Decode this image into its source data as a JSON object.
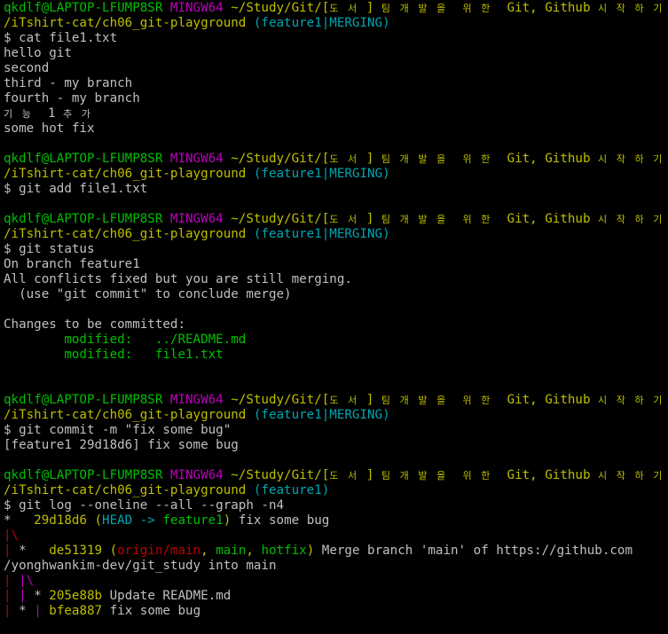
{
  "terminal": {
    "background": "#000000",
    "lines": [
      {
        "segments": [
          {
            "text": "qkdlf@LAPTOP-LFUMP8SR ",
            "color": "green"
          },
          {
            "text": "MINGW64 ",
            "color": "magenta"
          },
          {
            "text": "~/Study/Git/[",
            "color": "yellow"
          },
          {
            "text": "도 서 ",
            "color": "yellow",
            "small": true
          },
          {
            "text": "] ",
            "color": "yellow"
          },
          {
            "text": "팀 개 발 을  위 한 ",
            "color": "yellow",
            "small": true
          },
          {
            "text": " Git, Github ",
            "color": "yellow"
          },
          {
            "text": "시 작 하 기",
            "color": "yellow",
            "small": true
          }
        ]
      },
      {
        "segments": [
          {
            "text": "/iTshirt-cat/ch06_git-playground ",
            "color": "yellow"
          },
          {
            "text": "(feature1|MERGING)",
            "color": "cyan"
          }
        ]
      },
      {
        "segments": [
          {
            "text": "$ cat file1.txt",
            "color": "default"
          }
        ]
      },
      {
        "segments": [
          {
            "text": "hello git",
            "color": "default"
          }
        ]
      },
      {
        "segments": [
          {
            "text": "second",
            "color": "default"
          }
        ]
      },
      {
        "segments": [
          {
            "text": "third - my branch",
            "color": "default"
          }
        ]
      },
      {
        "segments": [
          {
            "text": "fourth - my branch",
            "color": "default"
          }
        ]
      },
      {
        "segments": [
          {
            "text": "기 능 ",
            "color": "default",
            "small": true
          },
          {
            "text": " 1 ",
            "color": "default"
          },
          {
            "text": "추 가",
            "color": "default",
            "small": true
          }
        ]
      },
      {
        "segments": [
          {
            "text": "some hot fix",
            "color": "default"
          }
        ]
      },
      {
        "segments": [
          {
            "text": "",
            "color": "default"
          }
        ]
      },
      {
        "segments": [
          {
            "text": "qkdlf@LAPTOP-LFUMP8SR ",
            "color": "green"
          },
          {
            "text": "MINGW64 ",
            "color": "magenta"
          },
          {
            "text": "~/Study/Git/[",
            "color": "yellow"
          },
          {
            "text": "도 서 ",
            "color": "yellow",
            "small": true
          },
          {
            "text": "] ",
            "color": "yellow"
          },
          {
            "text": "팀 개 발 을  위 한 ",
            "color": "yellow",
            "small": true
          },
          {
            "text": " Git, Github ",
            "color": "yellow"
          },
          {
            "text": "시 작 하 기",
            "color": "yellow",
            "small": true
          }
        ]
      },
      {
        "segments": [
          {
            "text": "/iTshirt-cat/ch06_git-playground ",
            "color": "yellow"
          },
          {
            "text": "(feature1|MERGING)",
            "color": "cyan"
          }
        ]
      },
      {
        "segments": [
          {
            "text": "$ git add file1.txt",
            "color": "default"
          }
        ]
      },
      {
        "segments": [
          {
            "text": "",
            "color": "default"
          }
        ]
      },
      {
        "segments": [
          {
            "text": "qkdlf@LAPTOP-LFUMP8SR ",
            "color": "green"
          },
          {
            "text": "MINGW64 ",
            "color": "magenta"
          },
          {
            "text": "~/Study/Git/[",
            "color": "yellow"
          },
          {
            "text": "도 서 ",
            "color": "yellow",
            "small": true
          },
          {
            "text": "] ",
            "color": "yellow"
          },
          {
            "text": "팀 개 발 을  위 한 ",
            "color": "yellow",
            "small": true
          },
          {
            "text": " Git, Github ",
            "color": "yellow"
          },
          {
            "text": "시 작 하 기",
            "color": "yellow",
            "small": true
          }
        ]
      },
      {
        "segments": [
          {
            "text": "/iTshirt-cat/ch06_git-playground ",
            "color": "yellow"
          },
          {
            "text": "(feature1|MERGING)",
            "color": "cyan"
          }
        ]
      },
      {
        "segments": [
          {
            "text": "$ git status",
            "color": "default"
          }
        ]
      },
      {
        "segments": [
          {
            "text": "On branch feature1",
            "color": "default"
          }
        ]
      },
      {
        "segments": [
          {
            "text": "All conflicts fixed but you are still merging.",
            "color": "default"
          }
        ]
      },
      {
        "segments": [
          {
            "text": "  (use \"git commit\" to conclude merge)",
            "color": "default"
          }
        ]
      },
      {
        "segments": [
          {
            "text": "",
            "color": "default"
          }
        ]
      },
      {
        "segments": [
          {
            "text": "Changes to be committed:",
            "color": "default"
          }
        ]
      },
      {
        "segments": [
          {
            "text": "        modified:   ../README.md",
            "color": "green"
          }
        ]
      },
      {
        "segments": [
          {
            "text": "        modified:   file1.txt",
            "color": "green"
          }
        ]
      },
      {
        "segments": [
          {
            "text": "",
            "color": "default"
          }
        ]
      },
      {
        "segments": [
          {
            "text": "",
            "color": "default"
          }
        ]
      },
      {
        "segments": [
          {
            "text": "qkdlf@LAPTOP-LFUMP8SR ",
            "color": "green"
          },
          {
            "text": "MINGW64 ",
            "color": "magenta"
          },
          {
            "text": "~/Study/Git/[",
            "color": "yellow"
          },
          {
            "text": "도 서 ",
            "color": "yellow",
            "small": true
          },
          {
            "text": "] ",
            "color": "yellow"
          },
          {
            "text": "팀 개 발 을  위 한 ",
            "color": "yellow",
            "small": true
          },
          {
            "text": " Git, Github ",
            "color": "yellow"
          },
          {
            "text": "시 작 하 기",
            "color": "yellow",
            "small": true
          }
        ]
      },
      {
        "segments": [
          {
            "text": "/iTshirt-cat/ch06_git-playground ",
            "color": "yellow"
          },
          {
            "text": "(feature1|MERGING)",
            "color": "cyan"
          }
        ]
      },
      {
        "segments": [
          {
            "text": "$ git commit -m \"fix some bug\"",
            "color": "default"
          }
        ]
      },
      {
        "segments": [
          {
            "text": "[feature1 29d18d6] fix some bug",
            "color": "default"
          }
        ]
      },
      {
        "segments": [
          {
            "text": "",
            "color": "default"
          }
        ]
      },
      {
        "segments": [
          {
            "text": "qkdlf@LAPTOP-LFUMP8SR ",
            "color": "green"
          },
          {
            "text": "MINGW64 ",
            "color": "magenta"
          },
          {
            "text": "~/Study/Git/[",
            "color": "yellow"
          },
          {
            "text": "도 서 ",
            "color": "yellow",
            "small": true
          },
          {
            "text": "] ",
            "color": "yellow"
          },
          {
            "text": "팀 개 발 을  위 한 ",
            "color": "yellow",
            "small": true
          },
          {
            "text": " Git, Github ",
            "color": "yellow"
          },
          {
            "text": "시 작 하 기",
            "color": "yellow",
            "small": true
          }
        ]
      },
      {
        "segments": [
          {
            "text": "/iTshirt-cat/ch06_git-playground ",
            "color": "yellow"
          },
          {
            "text": "(feature1)",
            "color": "cyan"
          }
        ]
      },
      {
        "segments": [
          {
            "text": "$ git log --oneline --all --graph -n4",
            "color": "default"
          }
        ]
      },
      {
        "segments": [
          {
            "text": "*   ",
            "color": "default"
          },
          {
            "text": "29d18d6 (",
            "color": "yellow"
          },
          {
            "text": "HEAD -> ",
            "color": "cyan"
          },
          {
            "text": "feature1",
            "color": "green"
          },
          {
            "text": ")",
            "color": "yellow"
          },
          {
            "text": " fix some bug",
            "color": "default"
          }
        ]
      },
      {
        "segments": [
          {
            "text": "|\\",
            "color": "red"
          }
        ]
      },
      {
        "segments": [
          {
            "text": "| ",
            "color": "red"
          },
          {
            "text": "*   ",
            "color": "default"
          },
          {
            "text": "de51319 (",
            "color": "yellow"
          },
          {
            "text": "origin/main",
            "color": "red"
          },
          {
            "text": ", ",
            "color": "yellow"
          },
          {
            "text": "main",
            "color": "green"
          },
          {
            "text": ", ",
            "color": "yellow"
          },
          {
            "text": "hotfix",
            "color": "green"
          },
          {
            "text": ")",
            "color": "yellow"
          },
          {
            "text": " Merge branch 'main' of https://github.com",
            "color": "default"
          }
        ]
      },
      {
        "segments": [
          {
            "text": "/yonghwankim-dev/git_study into main",
            "color": "default"
          }
        ]
      },
      {
        "segments": [
          {
            "text": "| ",
            "color": "red"
          },
          {
            "text": "|\\",
            "color": "magenta"
          }
        ]
      },
      {
        "segments": [
          {
            "text": "| ",
            "color": "red"
          },
          {
            "text": "| ",
            "color": "magenta"
          },
          {
            "text": "* ",
            "color": "default"
          },
          {
            "text": "205e88b",
            "color": "yellow"
          },
          {
            "text": " Update README.md",
            "color": "default"
          }
        ]
      },
      {
        "segments": [
          {
            "text": "| ",
            "color": "red"
          },
          {
            "text": "* ",
            "color": "default"
          },
          {
            "text": "| ",
            "color": "magenta"
          },
          {
            "text": "bfea887",
            "color": "yellow"
          },
          {
            "text": " fix some bug",
            "color": "default"
          }
        ]
      }
    ]
  },
  "colors": {
    "green": "#00bf00",
    "magenta": "#bf00bf",
    "yellow": "#bfbf00",
    "cyan": "#00a6b2",
    "red": "#bf0000",
    "default": "#c0c0c0"
  }
}
